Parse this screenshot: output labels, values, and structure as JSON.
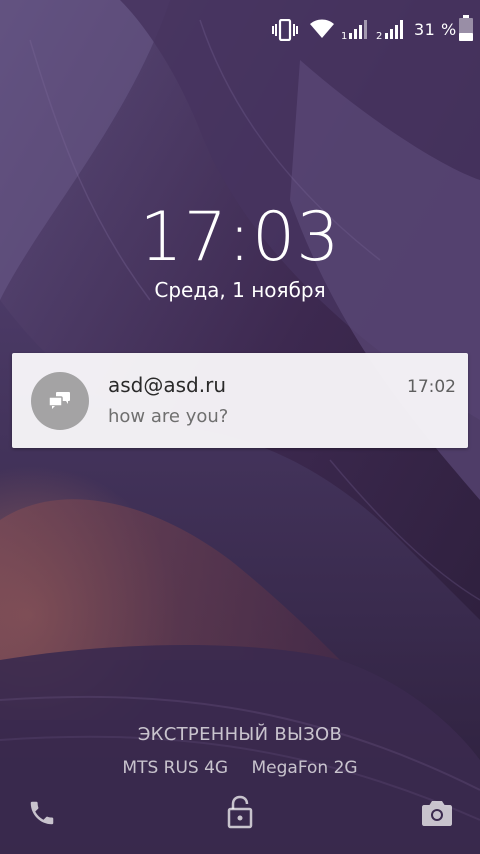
{
  "status_bar": {
    "battery_percent": "31 %",
    "sim1_label": "1",
    "sim2_label": "2",
    "icons": [
      "vibrate-icon",
      "wifi-icon",
      "signal-sim1-icon",
      "signal-sim2-icon",
      "battery-icon"
    ]
  },
  "lockscreen": {
    "time": "17:03",
    "date": "Среда, 1 ноября"
  },
  "notification": {
    "icon": "chat-bubbles-icon",
    "title": "asd@asd.ru",
    "time": "17:02",
    "body": "how are you?"
  },
  "footer": {
    "emergency_label": "ЭКСТРЕННЫЙ ВЫЗОВ",
    "carriers": [
      "MTS RUS 4G",
      "MegaFon 2G"
    ],
    "icons": [
      "phone-icon",
      "unlock-icon",
      "camera-icon"
    ]
  },
  "colors": {
    "wallpaper_base": "#3a2547",
    "notification_bg": "#f8f6f9",
    "avatar_bg": "#a4a3a4"
  }
}
